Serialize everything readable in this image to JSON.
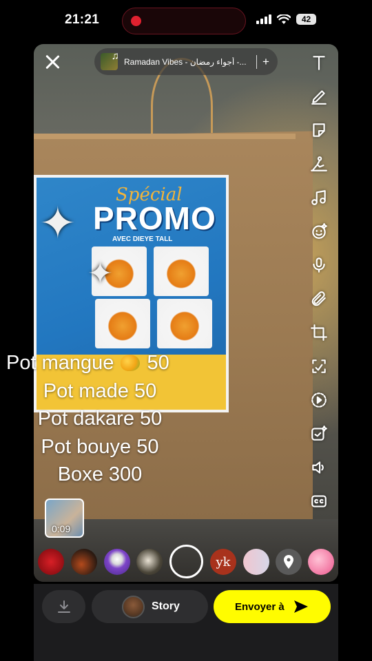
{
  "status_bar": {
    "time": "21:21",
    "battery": "42",
    "icons": [
      "signal-icon",
      "wifi-icon",
      "battery-icon"
    ],
    "recording_color": "#e0212f"
  },
  "top_bar": {
    "close_icon": "close-icon",
    "music": {
      "title": "Ramadan Vibes - أجواء رمضان -...",
      "add_label": "+"
    }
  },
  "photo": {
    "flyer_special": "Spécial",
    "flyer_promo": "PROMO",
    "flyer_avec": "AVEC DIEYE TALL"
  },
  "toolbar": {
    "items": [
      "text-icon",
      "pencil-icon",
      "sticker-icon",
      "scissors-icon",
      "music-icon",
      "lens-icon",
      "microphone-icon",
      "paperclip-icon",
      "crop-icon",
      "magic-icon",
      "speed-icon",
      "ai-sticker-icon",
      "volume-icon",
      "captions-icon"
    ],
    "text_glyph": "T"
  },
  "caption": {
    "lines": [
      "Pot mangue",
      "50",
      "Pot made 50",
      "Pot dakare 50",
      "Pot bouye 50",
      "Boxe 300"
    ]
  },
  "clip": {
    "duration": "0:09"
  },
  "lenses": {
    "yk_label": "yk"
  },
  "bottom_bar": {
    "story_label": "Story",
    "send_label": "Envoyer à",
    "accent": "#fffc00"
  }
}
